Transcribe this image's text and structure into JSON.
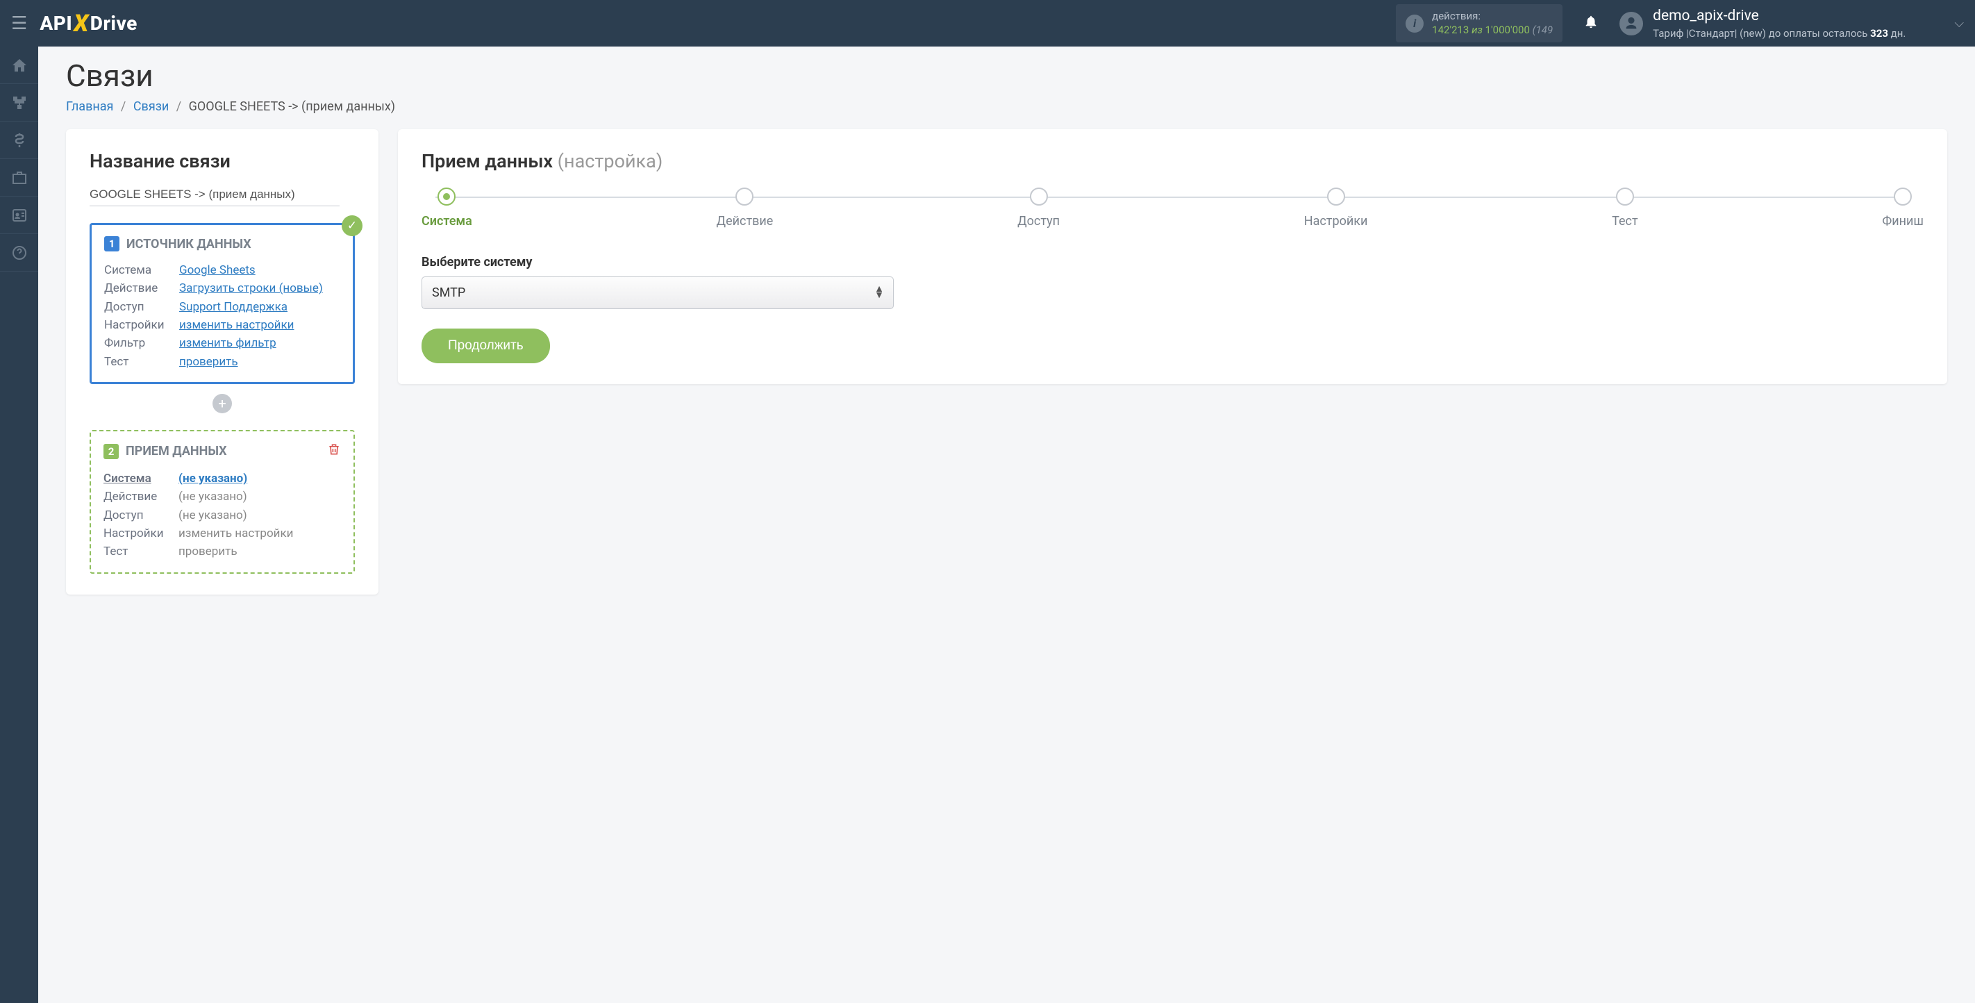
{
  "header": {
    "actions_label": "действия:",
    "actions_used": "142'213",
    "actions_of": "из",
    "actions_total": "1'000'000",
    "actions_extra": "(149",
    "user_name": "demo_apix-drive",
    "tariff_prefix": "Тариф |Стандарт| (new) до оплаты осталось ",
    "tariff_days": "323",
    "tariff_suffix": " дн."
  },
  "page": {
    "title": "Связи"
  },
  "breadcrumbs": {
    "home": "Главная",
    "links": "Связи",
    "current": "GOOGLE SHEETS -> (прием данных)"
  },
  "left": {
    "heading": "Название связи",
    "conn_name": "GOOGLE SHEETS -> (прием данных)",
    "block1": {
      "title": "ИСТОЧНИК ДАННЫХ",
      "rows": {
        "system_k": "Система",
        "system_v": "Google Sheets",
        "action_k": "Действие",
        "action_v": "Загрузить строки (новые)",
        "access_k": "Доступ",
        "access_v": "Support Поддержка",
        "settings_k": "Настройки",
        "settings_v": "изменить настройки",
        "filter_k": "Фильтр",
        "filter_v": "изменить фильтр",
        "test_k": "Тест",
        "test_v": "проверить"
      }
    },
    "block2": {
      "title": "ПРИЕМ ДАННЫХ",
      "rows": {
        "system_k": "Система",
        "system_v": "(не указано)",
        "action_k": "Действие",
        "action_v": "(не указано)",
        "access_k": "Доступ",
        "access_v": "(не указано)",
        "settings_k": "Настройки",
        "settings_v": "изменить настройки",
        "test_k": "Тест",
        "test_v": "проверить"
      }
    }
  },
  "right": {
    "heading_main": "Прием данных",
    "heading_sub": "(настройка)",
    "steps": {
      "s1": "Система",
      "s2": "Действие",
      "s3": "Доступ",
      "s4": "Настройки",
      "s5": "Тест",
      "s6": "Финиш"
    },
    "select_label": "Выберите систему",
    "select_value": "SMTP",
    "continue": "Продолжить"
  }
}
